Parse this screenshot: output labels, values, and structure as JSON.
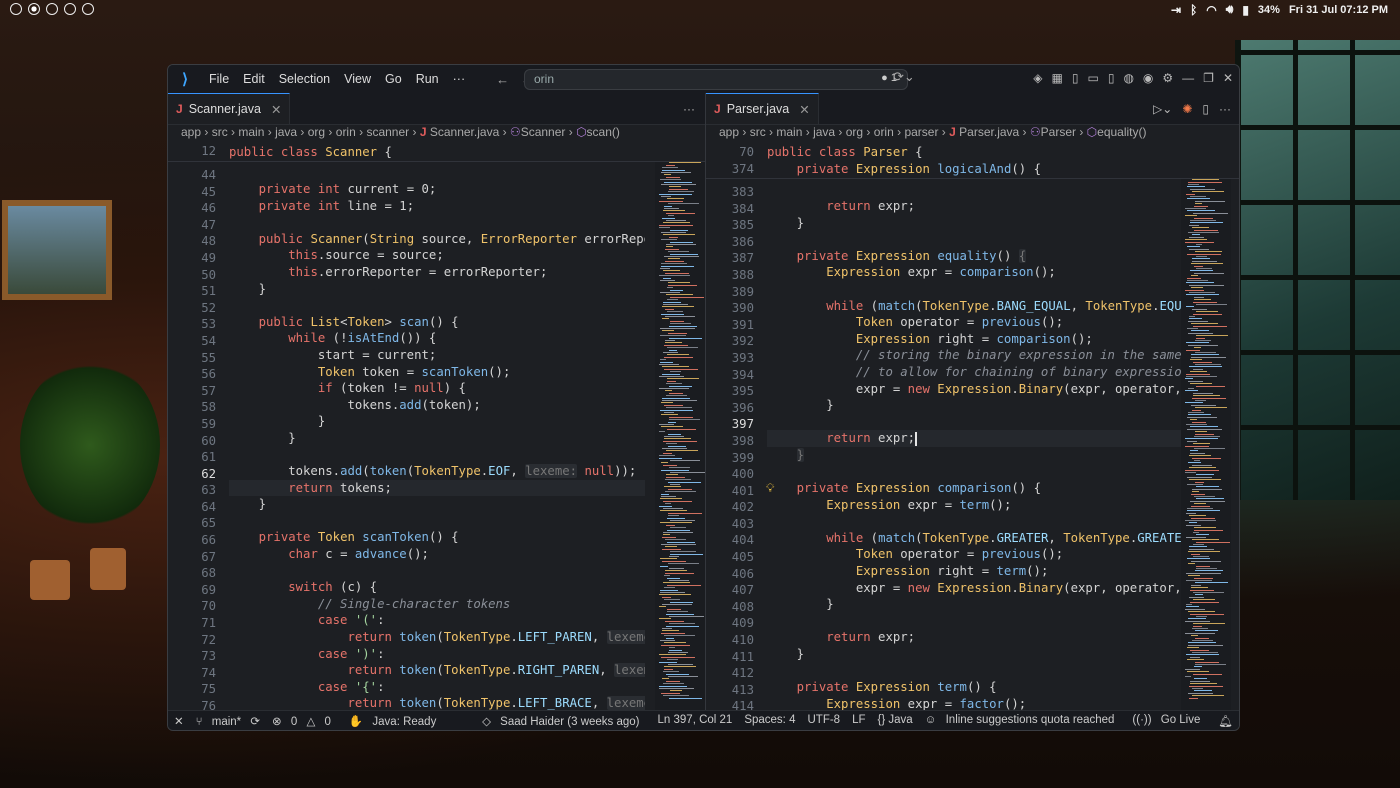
{
  "menubar": {
    "time": "Fri 31 Jul 07:12 PM",
    "battery": "34%"
  },
  "titlebar": {
    "menu": [
      "File",
      "Edit",
      "Selection",
      "View",
      "Go",
      "Run",
      "···"
    ],
    "search": "orin",
    "changes": "● 1"
  },
  "left": {
    "tab": "Scanner.java",
    "crumb": [
      "app",
      "src",
      "main",
      "java",
      "org",
      "orin",
      "scanner"
    ],
    "crumb_file": "Scanner.java",
    "crumb_class": "Scanner",
    "crumb_method": "scan()",
    "sticky_line": "12",
    "sticky_code": "public class Scanner {",
    "lines": [
      "44",
      "45",
      "46",
      "47",
      "48",
      "49",
      "50",
      "51",
      "52",
      "53",
      "54",
      "55",
      "56",
      "57",
      "58",
      "59",
      "60",
      "61",
      "62",
      "63",
      "64",
      "65",
      "66",
      "67",
      "68",
      "69",
      "70",
      "71",
      "72",
      "73",
      "74",
      "75",
      "76"
    ],
    "cursor_line": "62"
  },
  "right": {
    "tab": "Parser.java",
    "crumb": [
      "app",
      "src",
      "main",
      "java",
      "org",
      "orin",
      "parser"
    ],
    "crumb_file": "Parser.java",
    "crumb_class": "Parser",
    "crumb_method": "equality()",
    "sticky_lines": [
      "70",
      "374"
    ],
    "sticky_code": [
      "public class Parser {",
      "    private Expression logicalAnd() {"
    ],
    "lines": [
      "383",
      "384",
      "385",
      "386",
      "387",
      "388",
      "389",
      "390",
      "391",
      "392",
      "393",
      "394",
      "395",
      "396",
      "397",
      "398",
      "399",
      "400",
      "401",
      "402",
      "403",
      "404",
      "405",
      "406",
      "407",
      "408",
      "409",
      "410",
      "411",
      "412",
      "413",
      "414"
    ],
    "cursor_line": "397"
  },
  "status": {
    "branch": "main*",
    "errors": "0",
    "warnings": "0",
    "java": "Java: Ready",
    "blame": "Saad Haider (3 weeks ago)",
    "pos": "Ln 397, Col 21",
    "spaces": "Spaces: 4",
    "enc": "UTF-8",
    "eol": "LF",
    "lang": "{} Java",
    "copilot": "Inline suggestions quota reached",
    "live": "Go Live"
  }
}
